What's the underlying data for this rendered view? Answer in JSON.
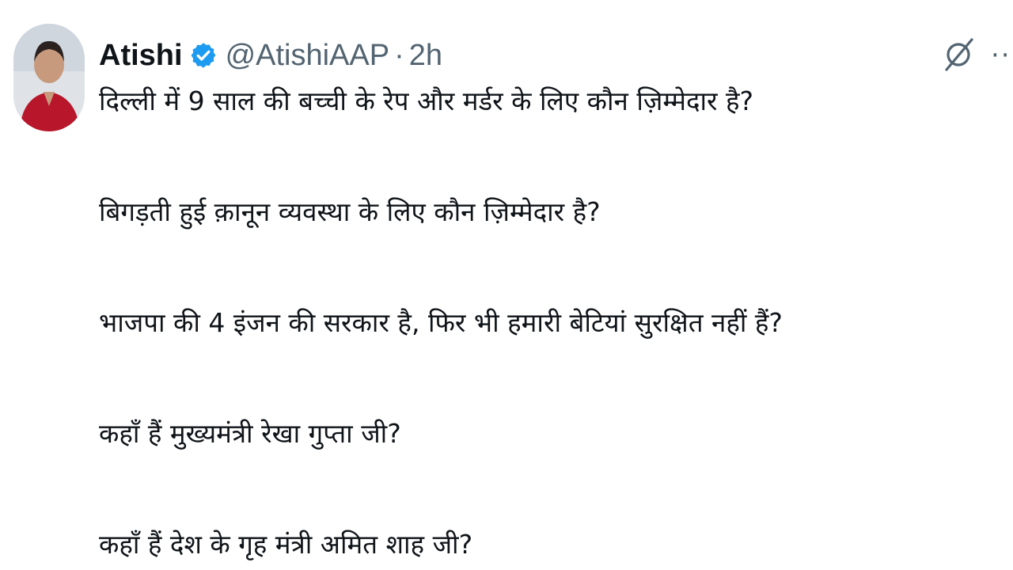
{
  "author": {
    "name": "Atishi",
    "handle": "@AtishiAAP",
    "separator": "·",
    "time": "2h",
    "verified_color": "#1d9bf0"
  },
  "icons": {
    "verified": "verified-badge-icon",
    "grok": "grok-icon",
    "more": "more-options-icon"
  },
  "post": {
    "lines": [
      "दिल्ली में 9 साल की बच्ची के रेप और मर्डर के लिए कौन ज़िम्मेदार है?",
      "बिगड़ती हुई क़ानून व्यवस्था के लिए कौन ज़िम्मेदार है?",
      "भाजपा की 4 इंजन की सरकार है, फिर भी हमारी बेटियां सुरक्षित नहीं हैं?",
      "कहाँ हैं मुख्यमंत्री रेखा गुप्ता जी?",
      "कहाँ हैं देश के गृह मंत्री अमित शाह जी?"
    ]
  },
  "colors": {
    "text": "#0f1419",
    "muted": "#536471",
    "accent": "#1d9bf0"
  }
}
